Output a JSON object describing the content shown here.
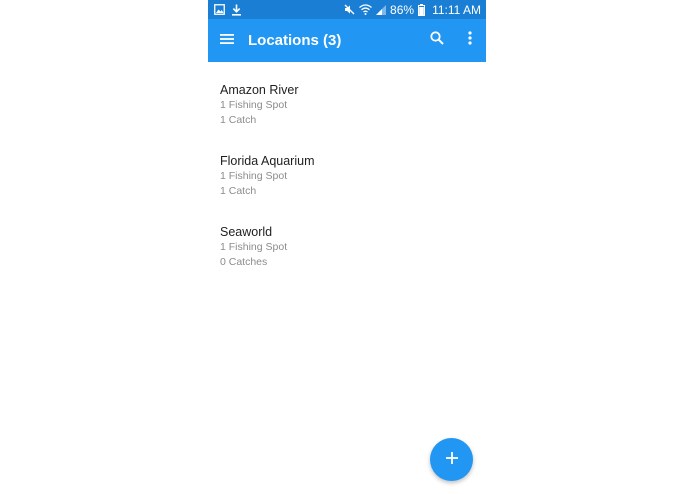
{
  "status_bar": {
    "battery": "86%",
    "time": "11:11 AM",
    "icons": [
      "image-icon",
      "download-icon",
      "mute-icon",
      "wifi-icon",
      "signal-icon",
      "battery-icon"
    ]
  },
  "app_bar": {
    "title": "Locations (3)",
    "icons": [
      "menu-icon",
      "search-icon",
      "more-vert-icon"
    ]
  },
  "locations": [
    {
      "name": "Amazon River",
      "spots": "1 Fishing Spot",
      "catches": "1 Catch"
    },
    {
      "name": "Florida Aquarium",
      "spots": "1 Fishing Spot",
      "catches": "1 Catch"
    },
    {
      "name": "Seaworld",
      "spots": "1 Fishing Spot",
      "catches": "0 Catches"
    }
  ],
  "fab": {
    "icon": "plus-icon"
  },
  "colors": {
    "status_bar": "#1a7fd4",
    "app_bar": "#2196f3",
    "fab": "#2196f3",
    "secondary_text": "#8c8c8c"
  }
}
